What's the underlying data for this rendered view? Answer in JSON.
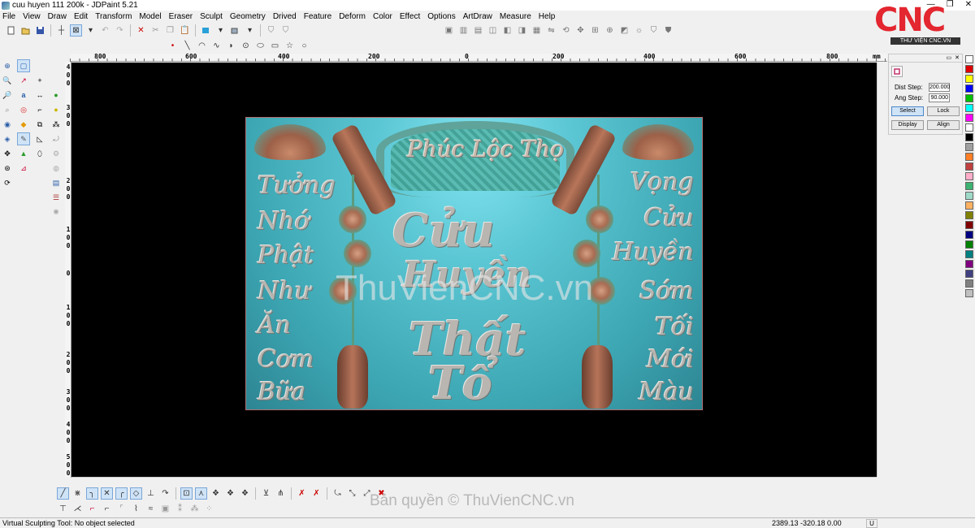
{
  "window": {
    "title": "cuu huyen 111 200k - JDPaint 5.21",
    "controls": [
      "—",
      "❐",
      "✕"
    ]
  },
  "menu": [
    "File",
    "View",
    "Draw",
    "Edit",
    "Transform",
    "Model",
    "Eraser",
    "Sculpt",
    "Geometry",
    "Drived",
    "Feature",
    "Deform",
    "Color",
    "Effect",
    "Options",
    "ArtDraw",
    "Measure",
    "Help"
  ],
  "logo": {
    "text": "CNC",
    "subtitle": "THƯ VIỆN CNC.VN",
    "color": "#e3262f"
  },
  "ruler": {
    "top_labels": [
      "800",
      "600",
      "400",
      "200",
      "0",
      "200",
      "400",
      "600",
      "800",
      "mm"
    ],
    "left_labels": [
      "4",
      "0",
      "0",
      "3",
      "0",
      "0",
      "2",
      "0",
      "0",
      "1",
      "0",
      "0",
      "0",
      "1",
      "0",
      "0",
      "2",
      "0",
      "0",
      "3",
      "0",
      "0",
      "4",
      "0",
      "0",
      "5",
      "0",
      "0"
    ]
  },
  "artwork": {
    "banner_title": "Phúc Lộc Thọ",
    "left_column": [
      "Tưởng",
      "Nhớ",
      "Phật",
      "Như",
      "Ăn",
      "Cơm",
      "Bữa"
    ],
    "right_column": [
      "Vọng",
      "Cửu",
      "Huyền",
      "Sớm",
      "Tối",
      "Mới",
      "Màu"
    ],
    "center_lines": [
      "Cửu",
      "Huyền",
      "Thất",
      "Tổ"
    ],
    "overlay_watermark": "ThuVienCNC.vn"
  },
  "right_panel": {
    "dist_step_label": "Dist Step:",
    "dist_step_value": "200.000",
    "ang_step_label": "Ang Step:",
    "ang_step_value": "90.000",
    "buttons": {
      "select": "Select",
      "lock": "Lock",
      "display": "Display",
      "align": "Align"
    }
  },
  "palette": [
    "#ffffff",
    "#e00000",
    "#ffff00",
    "#0000ff",
    "#00c000",
    "#00ffff",
    "#ff00ff",
    "#ffffff",
    "#000000",
    "#a0a0a0",
    "#ff7f27",
    "#c04040",
    "#ffaec9",
    "#3cb371",
    "#9fd9c8",
    "#ffb060",
    "#808000",
    "#800000",
    "#000080",
    "#008000",
    "#008080",
    "#800080",
    "#404080",
    "#808080",
    "#c0c0c0"
  ],
  "bottom_watermark": "Bản quyền © ThuVienCNC.vn",
  "status": {
    "text": "Virtual Sculpting Tool: No object selected",
    "coords": "2389.13 -320.18 0.00",
    "units": "U"
  }
}
